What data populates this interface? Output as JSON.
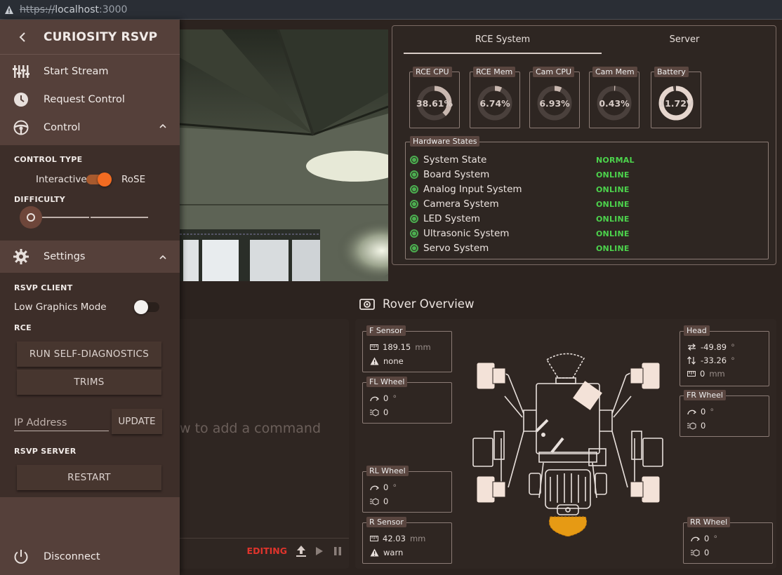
{
  "browser": {
    "scheme": "https://",
    "host": "localhost",
    "port": ":3000"
  },
  "drawer": {
    "title": "CURIOSITY RSVP",
    "nav": {
      "start_stream": "Start Stream",
      "request_control": "Request Control",
      "control": "Control"
    },
    "control": {
      "control_type_label": "CONTROL TYPE",
      "toggle_left": "Interactive",
      "toggle_right": "RoSE",
      "toggle_on": true,
      "difficulty_label": "DIFFICULTY",
      "difficulty_value": 0
    },
    "settings_label": "Settings",
    "settings": {
      "rsvp_client_label": "RSVP CLIENT",
      "low_graphics_label": "Low Graphics Mode",
      "low_graphics_on": false,
      "rce_label": "RCE",
      "self_diag_button": "RUN SELF-DIAGNOSTICS",
      "trims_button": "TRIMS",
      "ip_placeholder": "IP Address",
      "update_button": "UPDATE",
      "rsvp_server_label": "RSVP SERVER",
      "restart_button": "RESTART"
    },
    "disconnect": "Disconnect"
  },
  "status": {
    "tabs": [
      "RCE System",
      "Server"
    ],
    "active_tab": 0,
    "gauges": [
      {
        "label": "RCE CPU",
        "value": "38.61%",
        "fraction": 0.3861
      },
      {
        "label": "RCE Mem",
        "value": "6.74%",
        "fraction": 0.0674
      },
      {
        "label": "Cam CPU",
        "value": "6.93%",
        "fraction": 0.0693
      },
      {
        "label": "Cam Mem",
        "value": "0.43%",
        "fraction": 0.0043
      },
      {
        "label": "Battery",
        "value": "11.72V",
        "fraction": 0.97
      }
    ],
    "hardware_label": "Hardware States",
    "hardware": [
      {
        "name": "System State",
        "state": "NORMAL"
      },
      {
        "name": "Board System",
        "state": "ONLINE"
      },
      {
        "name": "Analog Input System",
        "state": "ONLINE"
      },
      {
        "name": "Camera System",
        "state": "ONLINE"
      },
      {
        "name": "LED System",
        "state": "ONLINE"
      },
      {
        "name": "Ultrasonic System",
        "state": "ONLINE"
      },
      {
        "name": "Servo System",
        "state": "ONLINE"
      }
    ]
  },
  "commands": {
    "placeholder": "w to add a command",
    "status": "EDITING"
  },
  "overview": {
    "title": "Rover Overview",
    "f_sensor": {
      "label": "F Sensor",
      "distance": "189.15",
      "unit": "mm",
      "status": "none"
    },
    "fl_wheel": {
      "label": "FL Wheel",
      "angle": "0",
      "deg": "°",
      "enc": "0"
    },
    "rl_wheel": {
      "label": "RL Wheel",
      "angle": "0",
      "deg": "°",
      "enc": "0"
    },
    "r_sensor": {
      "label": "R Sensor",
      "distance": "42.03",
      "unit": "mm",
      "status": "warn"
    },
    "head": {
      "label": "Head",
      "pan": "-49.89",
      "tilt": "-33.26",
      "deg": "°",
      "height": "0",
      "unit": "mm"
    },
    "fr_wheel": {
      "label": "FR Wheel",
      "angle": "0",
      "deg": "°",
      "enc": "0"
    },
    "rr_wheel": {
      "label": "RR Wheel",
      "angle": "0",
      "deg": "°",
      "enc": "0"
    }
  },
  "colors": {
    "accent": "#f26b21",
    "ok": "#4cd34c",
    "warn": "#e69a14",
    "drawer": "#55403a"
  }
}
